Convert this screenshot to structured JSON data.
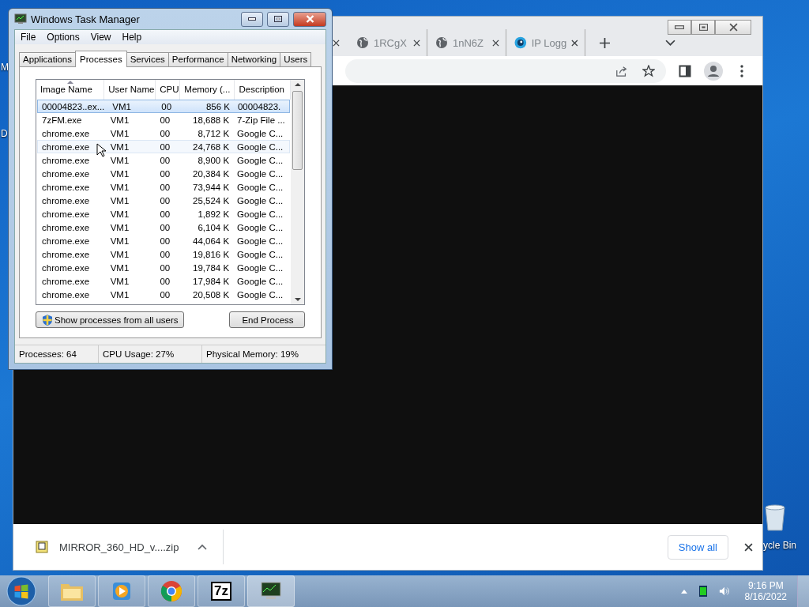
{
  "desktop": {
    "icon_labels": [
      {
        "text": "M"
      },
      {
        "text": "D"
      }
    ],
    "recycle_bin": {
      "label": "ycle Bin"
    }
  },
  "browser": {
    "tabs": [
      {
        "title": "1RCgX",
        "selected": false
      },
      {
        "title": "1nN6Z",
        "selected": false
      },
      {
        "title": "IP Logg",
        "selected": false
      }
    ],
    "download": {
      "filename": "MIRROR_360_HD_v....zip"
    },
    "show_all": "Show all"
  },
  "task_manager": {
    "title": "Windows Task Manager",
    "menu": [
      "File",
      "Options",
      "View",
      "Help"
    ],
    "tabs": [
      {
        "label": "Applications",
        "selected": false
      },
      {
        "label": "Processes",
        "selected": true
      },
      {
        "label": "Services",
        "selected": false
      },
      {
        "label": "Performance",
        "selected": false
      },
      {
        "label": "Networking",
        "selected": false
      },
      {
        "label": "Users",
        "selected": false
      }
    ],
    "columns": [
      {
        "label": "Image Name",
        "sorted": true
      },
      {
        "label": "User Name",
        "sorted": false
      },
      {
        "label": "CPU",
        "sorted": false
      },
      {
        "label": "Memory (...",
        "sorted": false
      },
      {
        "label": "Description",
        "sorted": false
      }
    ],
    "rows": [
      {
        "cells": [
          "00004823..ex...",
          "VM1",
          "00",
          "856 K",
          "00004823."
        ],
        "selected": true,
        "hovered": false
      },
      {
        "cells": [
          "7zFM.exe",
          "VM1",
          "00",
          "18,688 K",
          "7-Zip File ..."
        ],
        "selected": false,
        "hovered": false
      },
      {
        "cells": [
          "chrome.exe",
          "VM1",
          "00",
          "8,712 K",
          "Google C..."
        ],
        "selected": false,
        "hovered": false
      },
      {
        "cells": [
          "chrome.exe",
          "VM1",
          "00",
          "24,768 K",
          "Google C..."
        ],
        "selected": false,
        "hovered": true
      },
      {
        "cells": [
          "chrome.exe",
          "VM1",
          "00",
          "8,900 K",
          "Google C..."
        ],
        "selected": false,
        "hovered": false
      },
      {
        "cells": [
          "chrome.exe",
          "VM1",
          "00",
          "20,384 K",
          "Google C..."
        ],
        "selected": false,
        "hovered": false
      },
      {
        "cells": [
          "chrome.exe",
          "VM1",
          "00",
          "73,944 K",
          "Google C..."
        ],
        "selected": false,
        "hovered": false
      },
      {
        "cells": [
          "chrome.exe",
          "VM1",
          "00",
          "25,524 K",
          "Google C..."
        ],
        "selected": false,
        "hovered": false
      },
      {
        "cells": [
          "chrome.exe",
          "VM1",
          "00",
          "1,892 K",
          "Google C..."
        ],
        "selected": false,
        "hovered": false
      },
      {
        "cells": [
          "chrome.exe",
          "VM1",
          "00",
          "6,104 K",
          "Google C..."
        ],
        "selected": false,
        "hovered": false
      },
      {
        "cells": [
          "chrome.exe",
          "VM1",
          "00",
          "44,064 K",
          "Google C..."
        ],
        "selected": false,
        "hovered": false
      },
      {
        "cells": [
          "chrome.exe",
          "VM1",
          "00",
          "19,816 K",
          "Google C..."
        ],
        "selected": false,
        "hovered": false
      },
      {
        "cells": [
          "chrome.exe",
          "VM1",
          "00",
          "19,784 K",
          "Google C..."
        ],
        "selected": false,
        "hovered": false
      },
      {
        "cells": [
          "chrome.exe",
          "VM1",
          "00",
          "17,984 K",
          "Google C..."
        ],
        "selected": false,
        "hovered": false
      },
      {
        "cells": [
          "chrome.exe",
          "VM1",
          "00",
          "20,508 K",
          "Google C..."
        ],
        "selected": false,
        "hovered": false
      }
    ],
    "show_all_button": "Show processes from all users",
    "end_button": "End Process",
    "status": [
      "Processes: 64",
      "CPU Usage: 27%",
      "Physical Memory: 19%"
    ]
  },
  "taskbar": {
    "apps": [
      {
        "kind": "explorer",
        "selected": false
      },
      {
        "kind": "media",
        "selected": false
      },
      {
        "kind": "chrome",
        "selected": false
      },
      {
        "kind": "sevenzip",
        "selected": false
      },
      {
        "kind": "taskmgr",
        "selected": true
      }
    ],
    "sevenzip_label": "7z",
    "time": "9:16 PM",
    "date": "8/16/2022"
  }
}
